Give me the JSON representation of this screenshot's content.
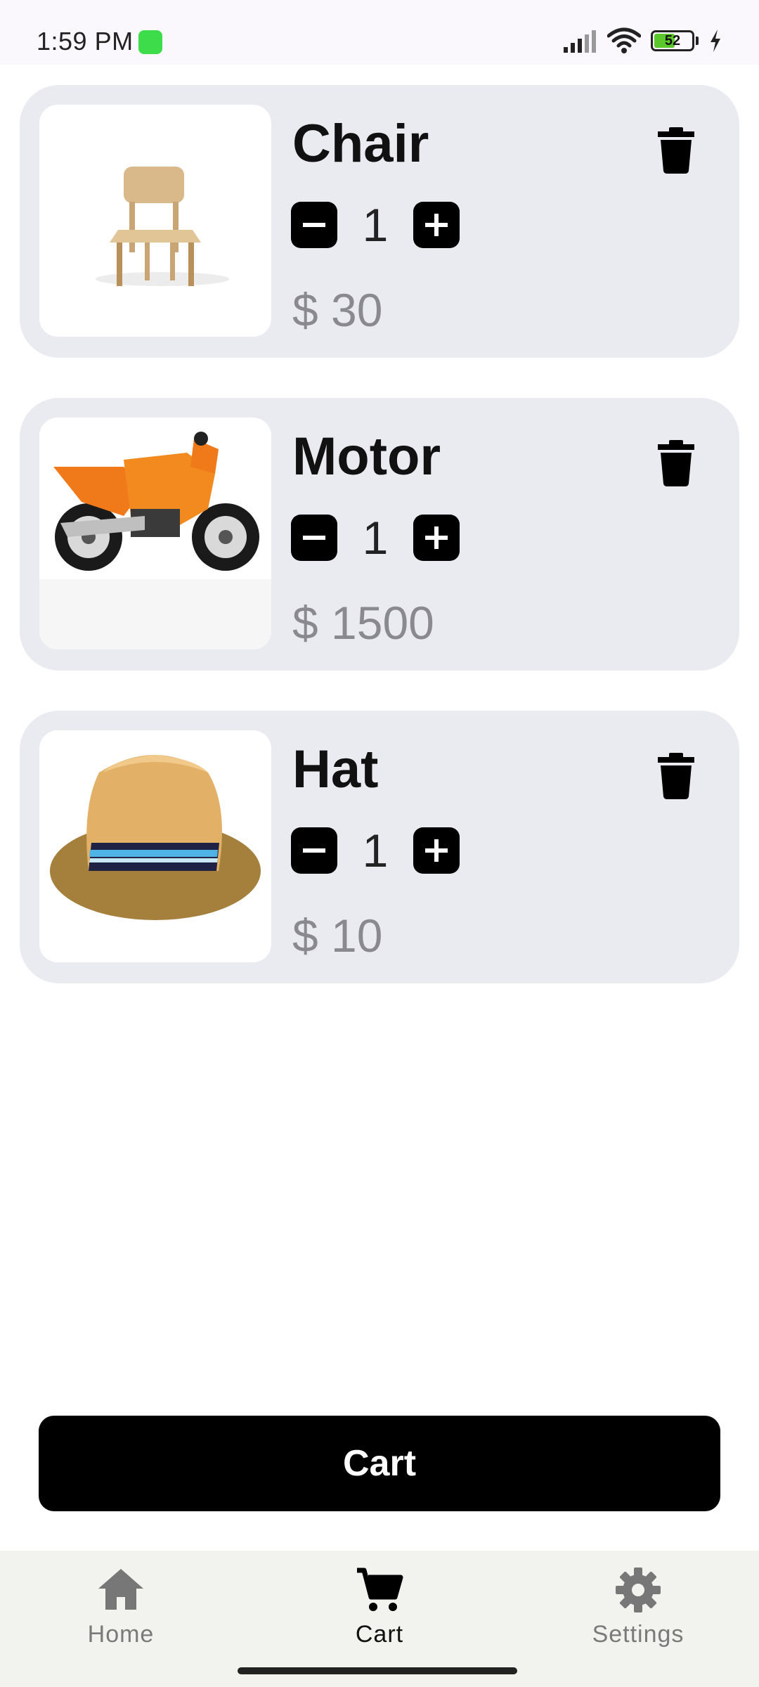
{
  "status_bar": {
    "time": "1:59 PM",
    "battery": "52",
    "icons": [
      "app-icon",
      "signal-icon",
      "wifi-icon",
      "battery-icon",
      "charging-icon"
    ]
  },
  "cart_items": [
    {
      "name": "Chair",
      "quantity": "1",
      "price": "$ 30",
      "image": "chair-image"
    },
    {
      "name": "Motor",
      "quantity": "1",
      "price": "$ 1500",
      "image": "motorcycle-image"
    },
    {
      "name": "Hat",
      "quantity": "1",
      "price": "$ 10",
      "image": "hat-image"
    }
  ],
  "cart_button": {
    "label": "Cart"
  },
  "bottom_nav": {
    "items": [
      {
        "label": "Home",
        "icon": "home-icon",
        "active": false
      },
      {
        "label": "Cart",
        "icon": "cart-icon",
        "active": true
      },
      {
        "label": "Settings",
        "icon": "settings-icon",
        "active": false
      }
    ]
  },
  "colors": {
    "card_bg": "#eaebf0",
    "price_text": "#8a8a8e",
    "button_bg": "#000000",
    "nav_bg": "#f2f2ef",
    "nav_inactive": "#7a7a7a"
  }
}
